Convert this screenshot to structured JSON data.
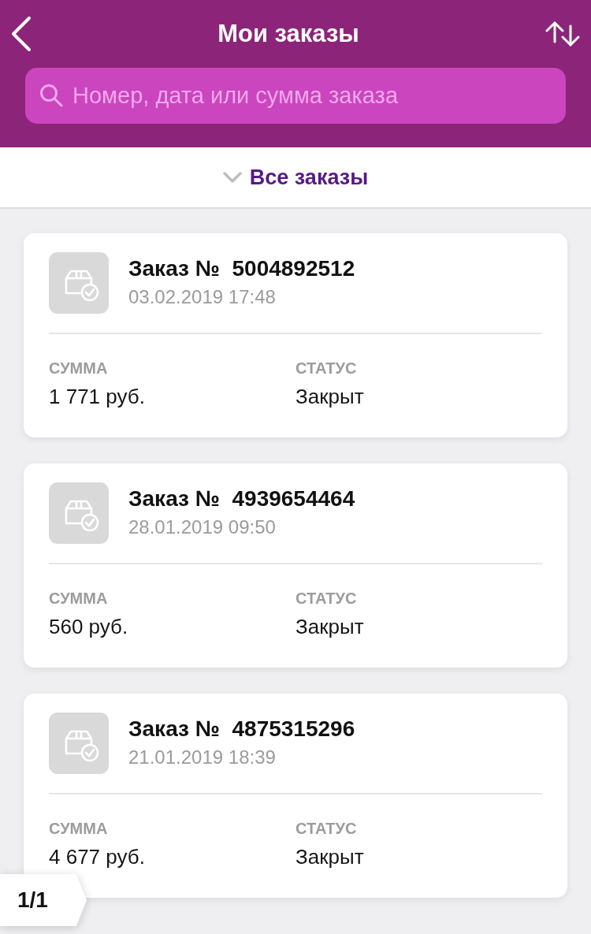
{
  "header": {
    "title": "Мои заказы"
  },
  "search": {
    "placeholder": "Номер, дата или сумма заказа"
  },
  "filter": {
    "label": "Все заказы"
  },
  "orders": [
    {
      "title": "Заказ №  5004892512",
      "date": "03.02.2019 17:48",
      "fields": [
        {
          "label": "СУММА",
          "value": "1 771 руб."
        },
        {
          "label": "СТАТУС",
          "value": "Закрыт"
        }
      ]
    },
    {
      "title": "Заказ №  4939654464",
      "date": "28.01.2019 09:50",
      "fields": [
        {
          "label": "СУММА",
          "value": "560 руб."
        },
        {
          "label": "СТАТУС",
          "value": "Закрыт"
        }
      ]
    },
    {
      "title": "Заказ №  4875315296",
      "date": "21.01.2019 18:39",
      "fields": [
        {
          "label": "СУММА",
          "value": "4 677 руб."
        },
        {
          "label": "СТАТУС",
          "value": "Закрыт"
        }
      ]
    }
  ],
  "pager": {
    "label": "1/1"
  }
}
